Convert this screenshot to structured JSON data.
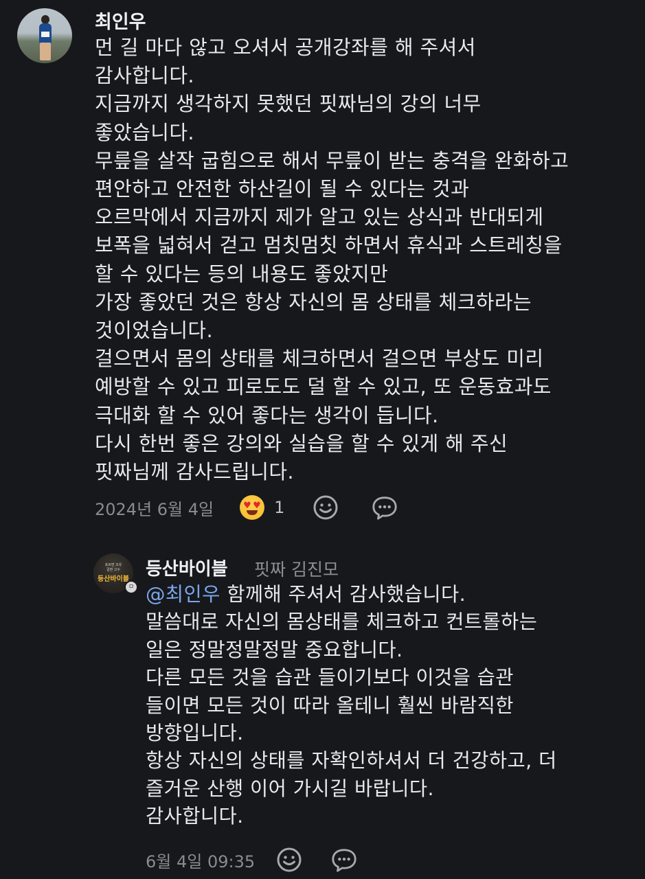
{
  "comment": {
    "author": "최인우",
    "lines": [
      "먼 길 마다 않고 오셔서 공개강좌를 해 주셔서",
      "감사합니다.",
      "지금까지 생각하지 못했던 핏짜님의 강의 너무",
      "좋았습니다.",
      "무릎을 살작 굽힘으로 해서 무릎이 받는 충격을 완화하고",
      "편안하고 안전한 하산길이 될 수 있다는 것과",
      "오르막에서 지금까지 제가 알고 있는 상식과 반대되게",
      "보폭을 넓혀서 걷고 멈칫멈칫 하면서 휴식과 스트레칭을",
      "할 수 있다는 등의 내용도 좋았지만",
      "가장 좋았던 것은 항상 자신의 몸 상태를 체크하라는",
      "것이었습니다.",
      "걸으면서 몸의 상태를 체크하면서 걸으면 부상도 미리",
      "예방할 수 있고 피로도도 덜 할 수 있고, 또 운동효과도",
      "극대화 할 수 있어 좋다는 생각이 듭니다.",
      "다시 한번 좋은 강의와 실습을 할 수 있게 해 주신",
      "핏짜님께 감사드립니다."
    ],
    "date": "2024년 6월 4일",
    "reaction_count": "1",
    "reaction_emoji": "heart-eyes-emoji"
  },
  "reply": {
    "author": "등산바이블",
    "subtitle": "핏짜 김진모",
    "avatar_small_text": "포르면 조유\n걸면 고수",
    "avatar_name": "등산바이블",
    "badge": "ㅁ",
    "mention": "@최인우",
    "first_line_rest": " 함께해 주셔서 감사했습니다.",
    "lines": [
      "말씀대로 자신의 몸상태를 체크하고 컨트롤하는",
      "일은 정말정말정말 중요합니다.",
      "다른 모든 것을 습관 들이기보다 이것을 습관",
      "들이면 모든 것이 따라 올테니 훨씬 바람직한",
      "방향입니다.",
      "항상 자신의 상태를 자확인하셔서 더 건강하고, 더",
      "즐거운 산행 이어 가시길 바랍니다.",
      "감사합니다."
    ],
    "date": "6월 4일 09:35"
  }
}
